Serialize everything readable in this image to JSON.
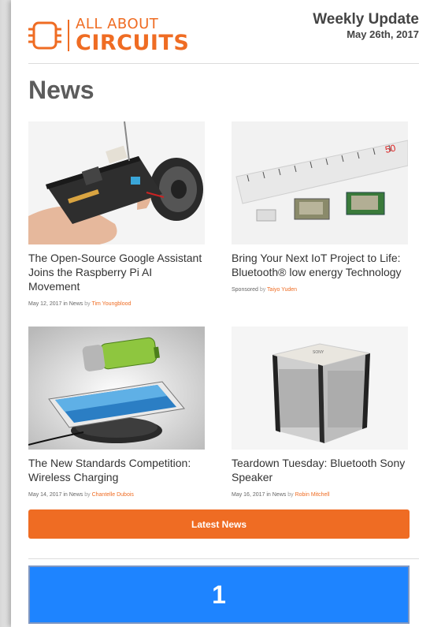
{
  "header": {
    "logo_top": "ALL ABOUT",
    "logo_bottom": "CIRCUITS",
    "weekly_title": "Weekly Update",
    "weekly_date": "May 26th, 2017"
  },
  "section": {
    "title": "News"
  },
  "articles": [
    {
      "title": "The Open-Source Google Assistant Joins the Raspberry Pi AI Movement",
      "meta_prefix": "May 12, 2017 in News",
      "by": "by",
      "author": "Tim Youngblood",
      "image": "circuit-board-speaker-photo"
    },
    {
      "title": "Bring Your Next IoT Project to Life: Bluetooth® low energy Technology",
      "meta_prefix": "Sponsored",
      "by": "by",
      "author": "Taiyo Yuden",
      "image": "ruler-bluetooth-modules-photo"
    },
    {
      "title": "The New Standards Competition: Wireless Charging",
      "meta_prefix": "May 14, 2017 in News",
      "by": "by",
      "author": "Chantelle Dubois",
      "image": "wireless-charging-phone-photo"
    },
    {
      "title": "Teardown Tuesday: Bluetooth Sony Speaker",
      "meta_prefix": "May 16, 2017 in News",
      "by": "by",
      "author": "Robin Mitchell",
      "image": "sony-speaker-photo"
    }
  ],
  "buttons": {
    "latest_news": "Latest News"
  },
  "blue_box": {
    "number": "1"
  },
  "colors": {
    "accent": "#ef6c23",
    "blue": "#1e84ff"
  }
}
